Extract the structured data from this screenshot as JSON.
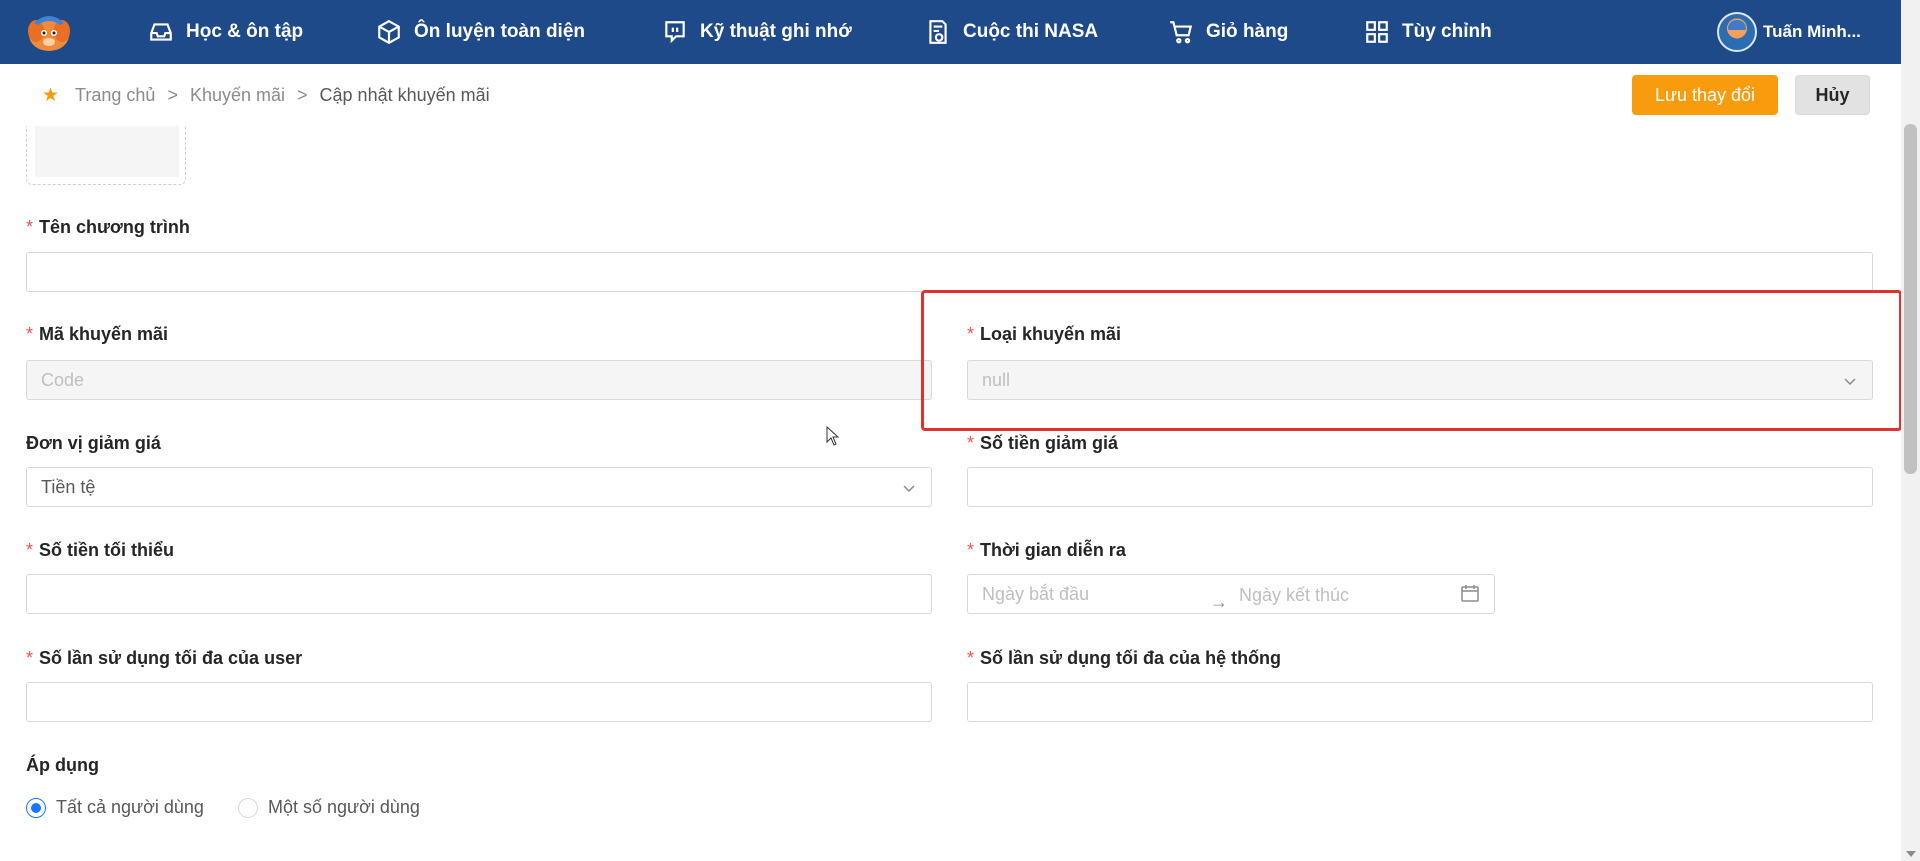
{
  "nav": {
    "items": [
      {
        "label": "Học & ôn tập",
        "icon": "inbox-icon"
      },
      {
        "label": "Ôn luyện toàn diện",
        "icon": "cube-icon"
      },
      {
        "label": "Kỹ thuật ghi nhớ",
        "icon": "chat-bubble-icon"
      },
      {
        "label": "Cuộc thi NASA",
        "icon": "document-badge-icon"
      },
      {
        "label": "Giỏ hàng",
        "icon": "cart-icon"
      },
      {
        "label": "Tùy chỉnh",
        "icon": "grid-icon"
      }
    ],
    "user_name": "Tuấn Minh..."
  },
  "breadcrumb": {
    "home": "Trang chủ",
    "section": "Khuyến mãi",
    "current": "Cập nhật khuyến mãi",
    "separator": ">"
  },
  "actions": {
    "save_label": "Lưu thay đổi",
    "cancel_label": "Hủy"
  },
  "form": {
    "program_name": {
      "label": "Tên chương trình",
      "value": ""
    },
    "promo_code": {
      "label": "Mã khuyến mãi",
      "placeholder": "Code"
    },
    "promo_type": {
      "label": "Loại khuyến mãi",
      "value": "null"
    },
    "discount_unit": {
      "label": "Đơn vị giảm giá",
      "value": "Tiền tệ"
    },
    "discount_amount": {
      "label": "Số tiền giảm giá",
      "value": ""
    },
    "min_amount": {
      "label": "Số tiền tối thiểu",
      "value": ""
    },
    "duration": {
      "label": "Thời gian diễn ra",
      "start_placeholder": "Ngày bắt đầu",
      "end_placeholder": "Ngày kết thúc",
      "separator": "→"
    },
    "max_use_user": {
      "label": "Số lần sử dụng tối đa của user",
      "value": ""
    },
    "max_use_system": {
      "label": "Số lần sử dụng tối đa của hệ thống",
      "value": ""
    },
    "apply": {
      "label": "Áp dụng",
      "options": [
        {
          "label": "Tất cả người dùng",
          "checked": true
        },
        {
          "label": "Một số người dùng",
          "checked": false
        }
      ]
    }
  },
  "colors": {
    "nav_bg": "#1f4a8a",
    "primary_button": "#f89c0e",
    "required_mark": "#ff4d4f",
    "highlight_box": "#e03131",
    "radio_active": "#1677ff"
  }
}
